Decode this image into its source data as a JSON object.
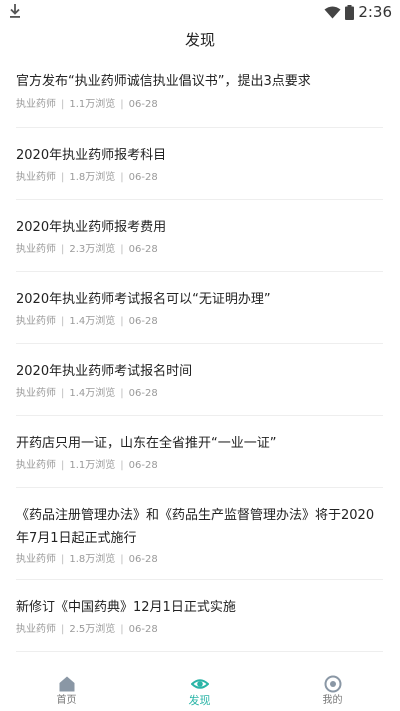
{
  "status_bar": {
    "time": "2:36",
    "icons": [
      "download-icon",
      "wifi-icon",
      "battery-icon"
    ]
  },
  "header": {
    "title": "发现"
  },
  "colors": {
    "accent": "#2bb5a7",
    "nav_inactive": "#8a97a5",
    "divider": "#eeeeee",
    "meta_text": "#9a9a9a"
  },
  "news": [
    {
      "title": "官方发布“执业药师诚信执业倡议书”，提出3点要求",
      "category": "执业药师",
      "views": "1.1万浏览",
      "date": "06-28"
    },
    {
      "title": "2020年执业药师报考科目",
      "category": "执业药师",
      "views": "1.8万浏览",
      "date": "06-28"
    },
    {
      "title": "2020年执业药师报考费用",
      "category": "执业药师",
      "views": "2.3万浏览",
      "date": "06-28"
    },
    {
      "title": "2020年执业药师考试报名可以“无证明办理”",
      "category": "执业药师",
      "views": "1.4万浏览",
      "date": "06-28"
    },
    {
      "title": "2020年执业药师考试报名时间",
      "category": "执业药师",
      "views": "1.4万浏览",
      "date": "06-28"
    },
    {
      "title": "开药店只用一证，山东在全省推开“一业一证”",
      "category": "执业药师",
      "views": "1.1万浏览",
      "date": "06-28"
    },
    {
      "title": "《药品注册管理办法》和《药品生产监督管理办法》将于2020年7月1日起正式施行",
      "category": "执业药师",
      "views": "1.8万浏览",
      "date": "06-28"
    },
    {
      "title": "新修订《中国药典》12月1日正式实施",
      "category": "执业药师",
      "views": "2.5万浏览",
      "date": "06-28"
    }
  ],
  "meta_separator": "|",
  "bottom_nav": {
    "items": [
      {
        "label": "首页",
        "icon": "home-icon",
        "active": false
      },
      {
        "label": "发现",
        "icon": "eye-icon",
        "active": true
      },
      {
        "label": "我的",
        "icon": "profile-icon",
        "active": false
      }
    ]
  }
}
